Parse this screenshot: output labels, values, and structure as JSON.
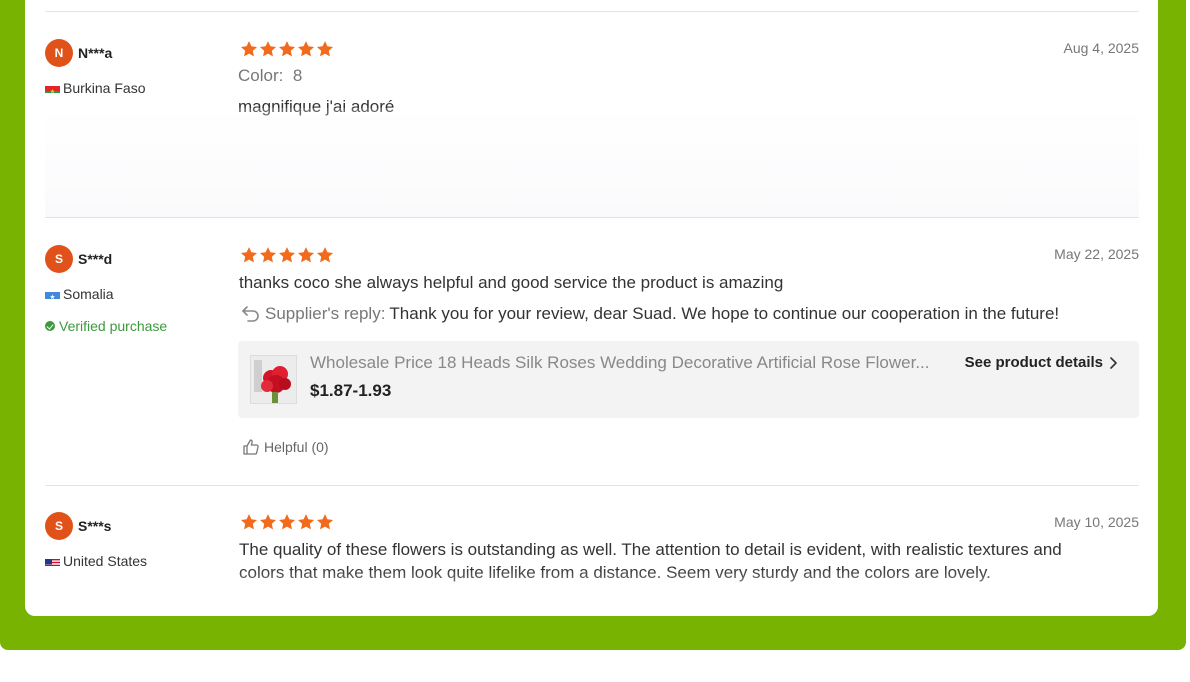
{
  "colors": {
    "frame_green": "#77b300",
    "avatar_orange": "#e0521a",
    "star_orange": "#f26a1b",
    "verified_green": "#3c9a3c"
  },
  "reviews": [
    {
      "avatar_letter": "N",
      "name": "N***a",
      "country": "Burkina Faso",
      "flag": "burkina-faso-flag",
      "rating": 5,
      "date": "Aug 4, 2025",
      "color_label": "Color:",
      "color_value": "8",
      "text": "magnifique j'ai adoré"
    },
    {
      "avatar_letter": "S",
      "name": "S***d",
      "country": "Somalia",
      "flag": "somalia-flag",
      "verified": "Verified purchase",
      "rating": 5,
      "date": "May 22, 2025",
      "text": "thanks coco she always helpful and good service the product is amazing",
      "reply_label": "Supplier's reply:",
      "reply_text": "Thank you for your review, dear Suad. We hope to continue our cooperation in the future!",
      "product": {
        "title": "Wholesale Price 18 Heads Silk Roses Wedding Decorative Artificial Rose Flower...",
        "price": "$1.87-1.93",
        "details_label": "See product details"
      },
      "helpful": "Helpful (0)"
    },
    {
      "avatar_letter": "S",
      "name": "S***s",
      "country": "United States",
      "flag": "united-states-flag",
      "rating": 5,
      "date": "May 10, 2025",
      "text_line1": "The quality of these flowers is outstanding as well. The attention to detail is evident, with realistic textures and",
      "text_line2": "colors that make them look quite lifelike from a distance. Seem very sturdy and the colors are lovely."
    }
  ]
}
